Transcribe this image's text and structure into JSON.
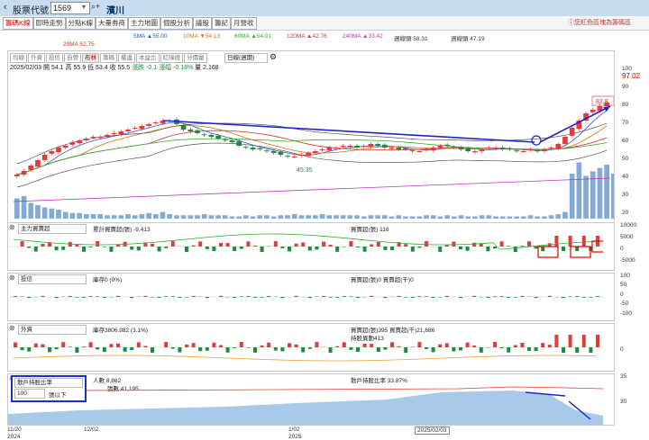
{
  "titlebar": {
    "title": "股票代號",
    "stock_code": "1569",
    "stock_name": "濱川"
  },
  "toolbar": {
    "tabs": [
      "籌碼K線",
      "即時走勢",
      "分點K線",
      "大量券商",
      "主力地圖",
      "個股分析",
      "議股",
      "籌記",
      "月營收"
    ],
    "active": 0,
    "link": "您紅色區塊為籌碼區"
  },
  "ma_legend": {
    "row1": [
      "5MA ▲55.00",
      "10MA ▼54.13",
      "60MA ▲54.01",
      "120MA ▲42.76",
      "240MA ▲33.42",
      "週線頭 58.31",
      "週線頭 47.19"
    ],
    "row2": "20MA 52.75"
  },
  "ohlc": {
    "date": "2025/02/03",
    "open": "開 54.1",
    "high": "高 55.9",
    "low": "低 53.4",
    "close": "收 55.5",
    "change": "漲跌 -0.1",
    "pct": "漲幅 -0.18%",
    "vol": "量 2,168"
  },
  "period_pills": [
    "均線",
    "外資",
    "投信",
    "自營",
    "布林",
    "籌碼",
    "擺盪",
    "本益比",
    "紅綠燈",
    "分價量"
  ],
  "period_selected": 4,
  "freq": "日線(週期)",
  "price_axis": [
    "100",
    "90",
    "80",
    "70",
    "60",
    "50",
    "40",
    "30",
    "20"
  ],
  "price_right_top": "97.02",
  "bubble_top": "82.8",
  "bubble_low": "45.35",
  "colors": {
    "up": "#e23b3b",
    "down": "#1f8a3b",
    "vol": "#6f9ccc",
    "arrow": "#2222cc",
    "highlight": "#e00000"
  },
  "panels": [
    {
      "select": "主力買賣超",
      "legend": "累計買賣超(張) -9,413",
      "right": "買賣超(張) 116",
      "axis": [
        "10000",
        "5000",
        "0",
        "-5000"
      ]
    },
    {
      "select": "投信",
      "legend": "庫存0 (0%)",
      "right": "買賣超(張)0 買賣超(千)0",
      "axis": [
        "100",
        "50",
        "0",
        "-50",
        "-100"
      ]
    },
    {
      "select": "外資",
      "legend": "庫存3806.982 (3.1%)",
      "right": "買賣超(張)395 買賣超(千)21,686",
      "right2": "持股異動413",
      "axis": [
        "0"
      ]
    },
    {
      "select": "散戶持股比率",
      "threshold": "100",
      "threshold_unit": "張以下",
      "legend": "人數 8,862",
      "legend2": "張數 41,195",
      "right": "散戶持股比率 33.87%",
      "axis": [
        "35",
        "30"
      ]
    }
  ],
  "date_axis": [
    {
      "d": "11/20",
      "y": "2024"
    },
    {
      "d": "12/02",
      "y": ""
    },
    {
      "d": "1/02",
      "y": "2025"
    },
    {
      "d": "2025/02/03",
      "y": ""
    }
  ]
}
